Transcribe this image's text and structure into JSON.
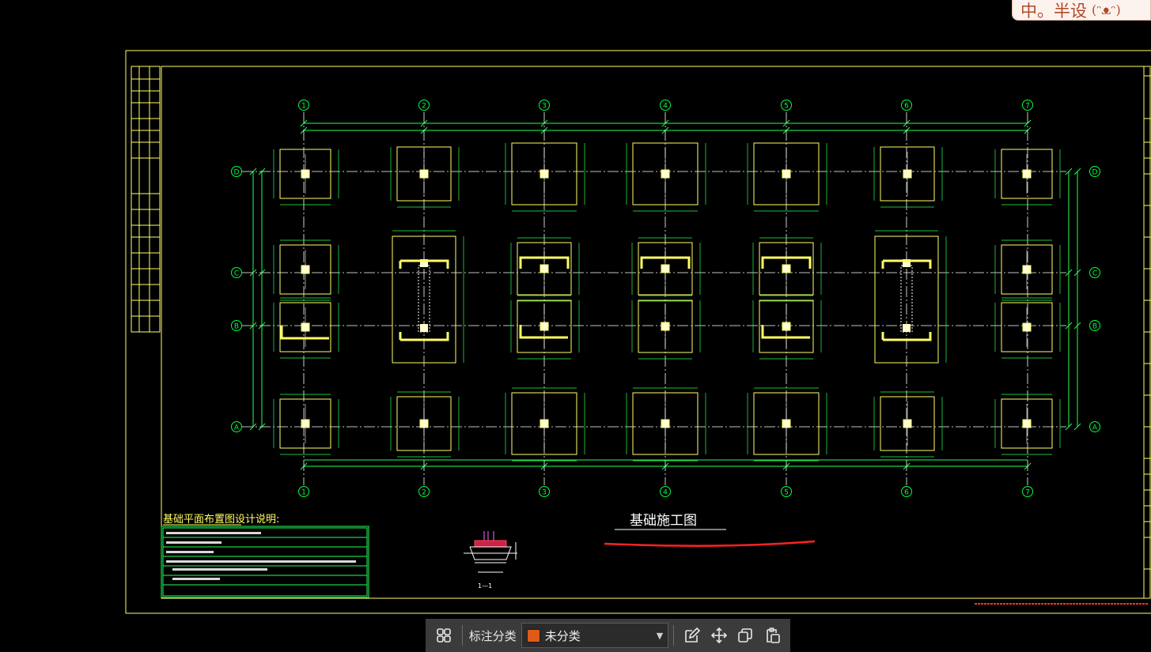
{
  "ime": {
    "text": "中。半设",
    "extra": "(ᵔᴥᵔ)"
  },
  "drawing": {
    "title": "基础施工图",
    "notes_title": "基础平面布置图设计说明:",
    "grid_cols": [
      "1",
      "2",
      "3",
      "4",
      "5",
      "6",
      "7"
    ],
    "grid_rows": [
      "D",
      "C",
      "B",
      "A"
    ],
    "section_label": "1—1"
  },
  "toolbar": {
    "label": "标注分类",
    "category": "未分类",
    "category_color": "#e05a1a"
  },
  "colors": {
    "frame": "#ffff66",
    "grid": "#00ff44",
    "dimension": "#22ff55",
    "footing": "#ffff66",
    "axis_line": "#ffffff",
    "annotation": "#ff2222"
  }
}
